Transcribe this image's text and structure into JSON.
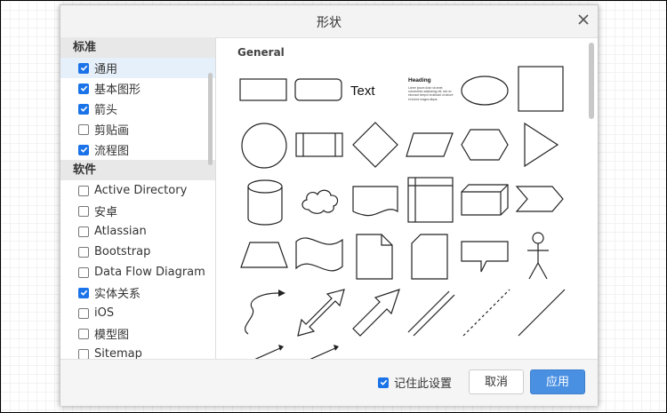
{
  "dialog": {
    "title": "形状",
    "close_icon": "close-icon"
  },
  "sidebar": {
    "categories": [
      {
        "label": "标准",
        "items": [
          {
            "label": "通用",
            "checked": true,
            "selected": true
          },
          {
            "label": "基本图形",
            "checked": true
          },
          {
            "label": "箭头",
            "checked": true
          },
          {
            "label": "剪贴画",
            "checked": false
          },
          {
            "label": "流程图",
            "checked": true
          }
        ]
      },
      {
        "label": "软件",
        "items": [
          {
            "label": "Active Directory",
            "checked": false
          },
          {
            "label": "安卓",
            "checked": false
          },
          {
            "label": "Atlassian",
            "checked": false
          },
          {
            "label": "Bootstrap",
            "checked": false
          },
          {
            "label": "Data Flow Diagram",
            "checked": false
          },
          {
            "label": "实体关系",
            "checked": true
          },
          {
            "label": "iOS",
            "checked": false
          },
          {
            "label": "模型图",
            "checked": false
          },
          {
            "label": "Sitemap",
            "checked": false
          }
        ]
      }
    ]
  },
  "main": {
    "section_title": "General",
    "shape_text_label": "Text",
    "heading_shape": {
      "title": "Heading",
      "body": "Lorem ipsum dolor sit amet, consectetur adipisicing elit, sed do eiusmod tempor incididunt ut labore et dolore magna aliqua."
    }
  },
  "footer": {
    "remember_label": "记住此设置",
    "remember_checked": true,
    "cancel_label": "取消",
    "apply_label": "应用"
  },
  "colors": {
    "accent": "#4a90e2",
    "checkbox": "#1a73e8",
    "selected_row": "#e6f0fa"
  }
}
